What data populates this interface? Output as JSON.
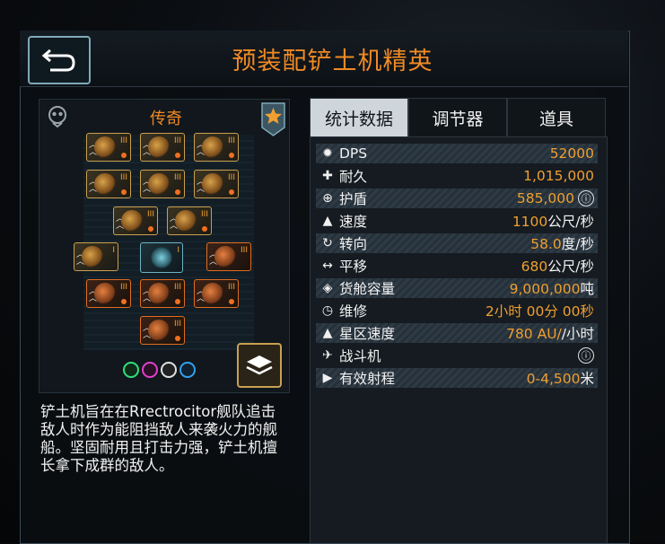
{
  "header": {
    "title": "预装配铲土机精英",
    "back_icon": "back-arrow-icon"
  },
  "ship": {
    "rarity": "传奇",
    "description": "铲土机旨在在Rrectrocitor舰队追击敌人时作为能阻挡敌人来袭火力的舰船。坚固耐用且打击力强，铲土机擅长拿下成群的敌人。"
  },
  "tabs": [
    {
      "label": "统计数据",
      "active": true
    },
    {
      "label": "调节器",
      "active": false
    },
    {
      "label": "道具",
      "active": false
    }
  ],
  "stats": [
    {
      "icon": "dps-icon",
      "label": "DPS",
      "value": "52000",
      "unit": "",
      "info": false
    },
    {
      "icon": "hull-icon",
      "label": "耐久",
      "value": "1,015,000",
      "unit": "",
      "info": false
    },
    {
      "icon": "shield-icon",
      "label": "护盾",
      "value": "585,000",
      "unit": "",
      "info": true
    },
    {
      "icon": "speed-icon",
      "label": "速度",
      "value": "1100",
      "unit": "公尺/秒",
      "info": false
    },
    {
      "icon": "turn-icon",
      "label": "转向",
      "value": "58.0",
      "unit": "度/秒",
      "info": false
    },
    {
      "icon": "strafe-icon",
      "label": "平移",
      "value": "680",
      "unit": "公尺/秒",
      "info": false
    },
    {
      "icon": "cargo-icon",
      "label": "货舱容量",
      "value": "9,000,000",
      "unit": "吨",
      "info": false
    },
    {
      "icon": "repair-icon",
      "label": "维修",
      "value": "2小时 00分 00秒",
      "unit": "",
      "info": false
    },
    {
      "icon": "warp-icon",
      "label": "星区速度",
      "value": "780 AU/",
      "unit": "/小时",
      "info": false
    },
    {
      "icon": "fighter-icon",
      "label": "战斗机",
      "value": "",
      "unit": "",
      "info": true
    },
    {
      "icon": "range-icon",
      "label": "有效射程",
      "value": "0-4,500",
      "unit": "米",
      "info": false
    }
  ],
  "info_glyph": "ⓘ",
  "colors": {
    "accent": "#f08a24",
    "value": "#f0a030",
    "gold_border": "#c9a04f",
    "orange_border": "#e06d1f"
  }
}
